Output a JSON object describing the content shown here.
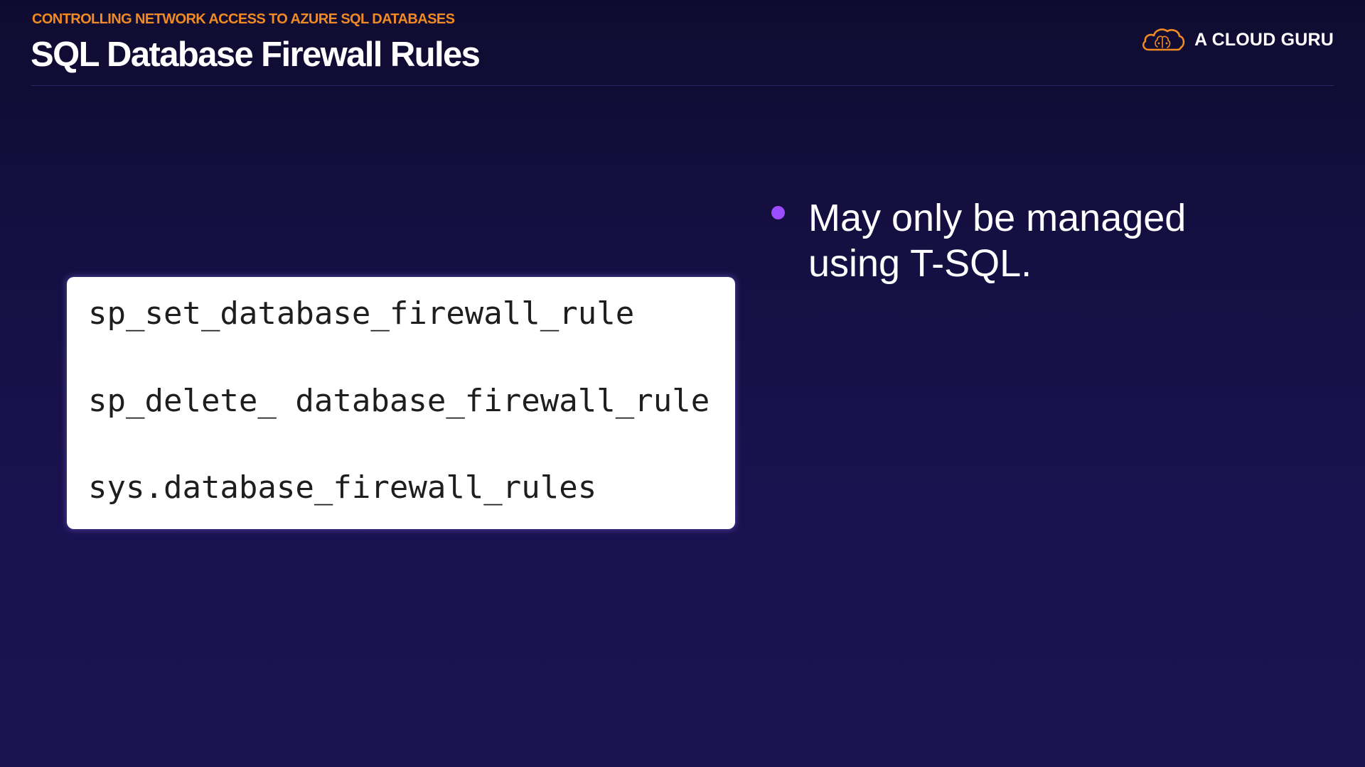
{
  "header": {
    "subtitle": "CONTROLLING NETWORK ACCESS TO AZURE SQL DATABASES",
    "title": "SQL Database Firewall Rules"
  },
  "logo": {
    "icon": "cloud-brain-icon",
    "text": "A CLOUD GURU",
    "accent_color": "#f08a24"
  },
  "code_box": {
    "lines": [
      "sp_set_database_firewall_rule",
      "sp_delete_ database_firewall_rule",
      "sys.database_firewall_rules"
    ]
  },
  "bullets": [
    {
      "icon": "bullet-dot-icon",
      "color": "#9b4dff",
      "text": "May only be managed using T-SQL."
    }
  ],
  "colors": {
    "background_top": "#0f0b30",
    "background_bottom": "#1c1353",
    "subtitle": "#f08a24",
    "bullet": "#9b4dff"
  }
}
